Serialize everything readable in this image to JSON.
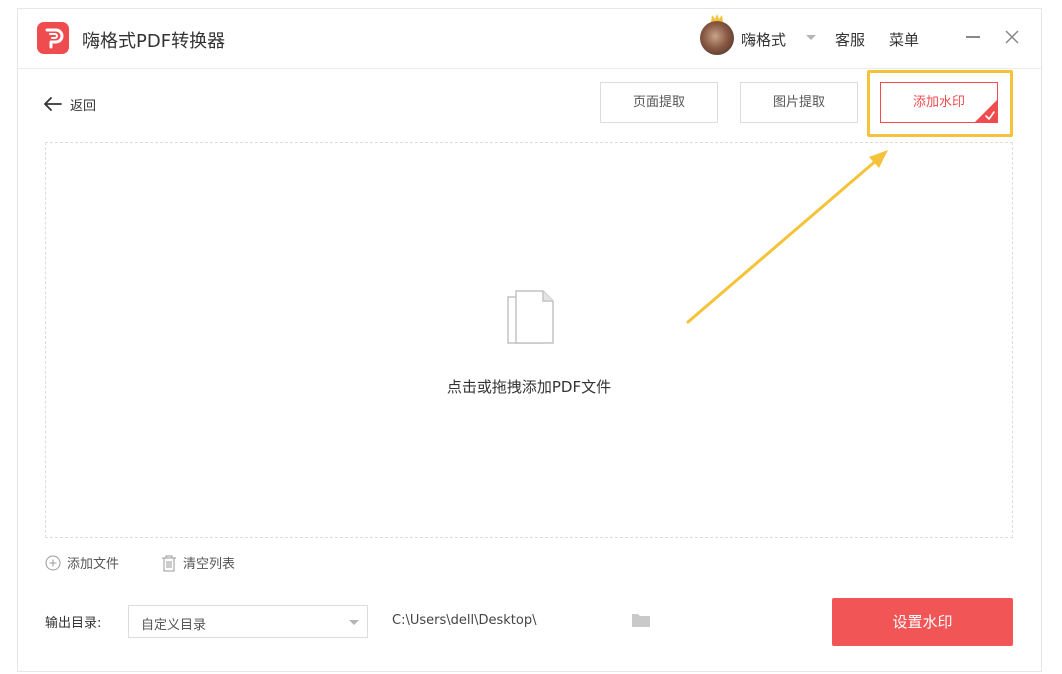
{
  "app": {
    "title": "嗨格式PDF转换器",
    "brand_color": "#ef4c4f"
  },
  "header": {
    "username": "嗨格式",
    "service_label": "客服",
    "menu_label": "菜单"
  },
  "toolbar": {
    "back_label": "返回",
    "tabs": [
      {
        "label": "页面提取",
        "active": false
      },
      {
        "label": "图片提取",
        "active": false
      },
      {
        "label": "添加水印",
        "active": true
      }
    ],
    "highlight_color": "#f4c33a"
  },
  "dropzone": {
    "hint": "点击或拖拽添加PDF文件",
    "icon": "document-icon"
  },
  "actions": {
    "add_file_label": "添加文件",
    "clear_list_label": "清空列表"
  },
  "output": {
    "label": "输出目录:",
    "select_value": "自定义目录",
    "path": "C:\\Users\\dell\\Desktop\\",
    "primary_button": "设置水印",
    "primary_color": "#f25555"
  }
}
